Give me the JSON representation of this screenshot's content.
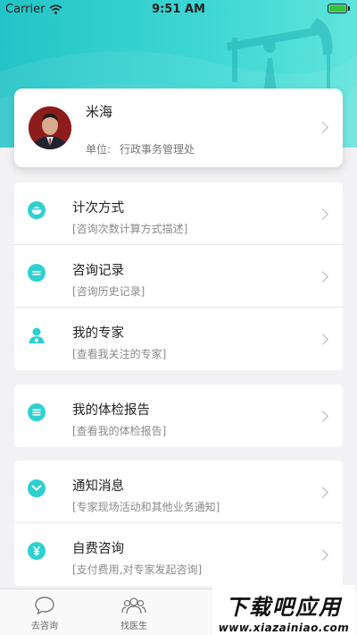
{
  "status_bar": {
    "carrier": "Carrier",
    "time": "9:51 AM"
  },
  "profile": {
    "name": "米海",
    "unit_label": "单位:",
    "unit_value": "行政事务管理处"
  },
  "groups": [
    {
      "items": [
        {
          "title": "计次方式",
          "subtitle": "[咨询次数计算方式描述]",
          "icon": "bowl-icon"
        },
        {
          "title": "咨询记录",
          "subtitle": "[咨询历史记录]",
          "icon": "list-icon"
        },
        {
          "title": "我的专家",
          "subtitle": "[查看我关注的专家]",
          "icon": "doctor-icon"
        }
      ]
    },
    {
      "items": [
        {
          "title": "我的体检报告",
          "subtitle": "[查看我的体检报告]",
          "icon": "report-icon"
        }
      ]
    },
    {
      "items": [
        {
          "title": "通知消息",
          "subtitle": "[专家现场活动和其他业务通知]",
          "icon": "message-icon"
        },
        {
          "title": "自费咨询",
          "subtitle": "[支付费用,对专家发起咨询]",
          "icon": "yuan-icon"
        }
      ]
    }
  ],
  "tabs": [
    {
      "label": "去咨询",
      "icon": "chat-bubble-icon"
    },
    {
      "label": "找医生",
      "icon": "people-icon"
    }
  ],
  "watermark": {
    "title": "下载吧应用",
    "url": "www.xiazainiao.com"
  },
  "colors": {
    "accent": "#2ed0d0",
    "header_gradient_start": "#23c4c7",
    "battery": "#35c23d"
  }
}
